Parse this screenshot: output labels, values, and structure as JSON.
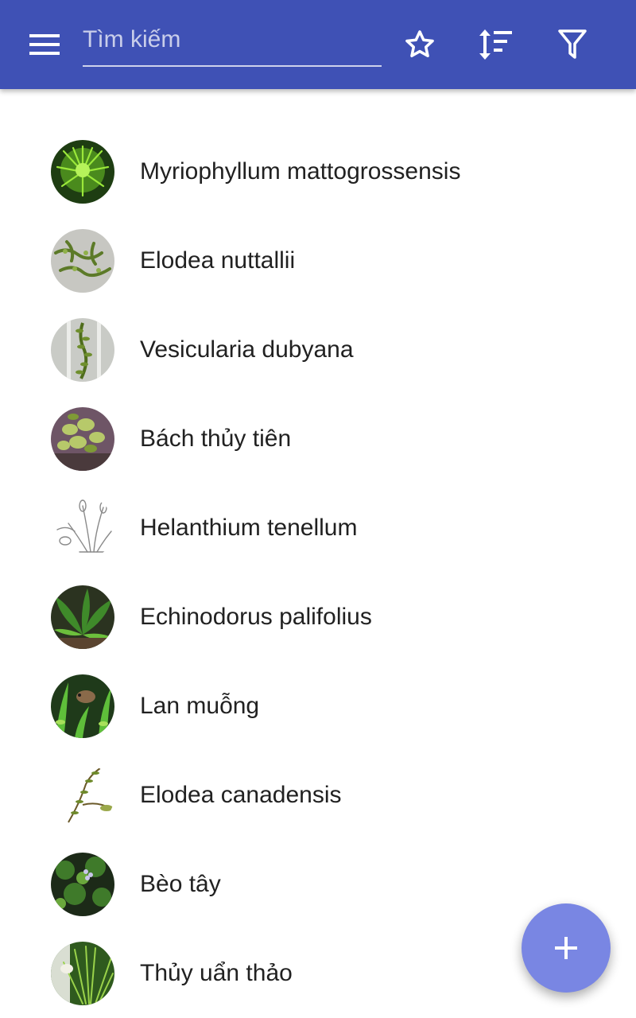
{
  "app_bar": {
    "color": "#3f51b5",
    "menu_icon": "hamburger-menu-icon",
    "search": {
      "placeholder": "Tìm kiếm",
      "value": ""
    },
    "actions": [
      {
        "icon": "star-outline-icon"
      },
      {
        "icon": "sort-icon"
      },
      {
        "icon": "filter-icon"
      }
    ]
  },
  "plants": [
    {
      "name": "Myriophyllum mattogrossensis",
      "thumbnail": "bright-green-bushy-plant"
    },
    {
      "name": "Elodea nuttallii",
      "thumbnail": "green-stems-on-grey"
    },
    {
      "name": "Vesicularia dubyana",
      "thumbnail": "moss-stem-in-glass"
    },
    {
      "name": "Bách thủy tiên",
      "thumbnail": "potted-leafy-plant"
    },
    {
      "name": "Helanthium tenellum",
      "thumbnail": "botanical-line-drawing"
    },
    {
      "name": "Echinodorus palifolius",
      "thumbnail": "broad-green-leaves"
    },
    {
      "name": "Lan muỗng",
      "thumbnail": "aquarium-plant-with-fish"
    },
    {
      "name": "Elodea canadensis",
      "thumbnail": "sprig-on-white"
    },
    {
      "name": "Bèo tây",
      "thumbnail": "water-hyacinth"
    },
    {
      "name": "Thủy uẩn thảo",
      "thumbnail": "feathery-green-plant"
    }
  ],
  "fab": {
    "icon": "plus-icon",
    "color": "#7986e3"
  }
}
